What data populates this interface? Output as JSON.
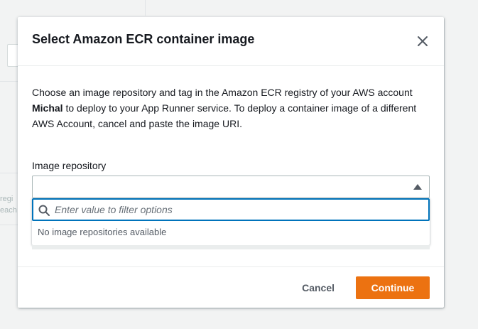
{
  "background": {
    "fragments": [
      "regi",
      "each"
    ]
  },
  "modal": {
    "title": "Select Amazon ECR container image",
    "close_icon": "close-icon",
    "description": {
      "part1": "Choose an image repository and tag in the Amazon ECR registry of your AWS account ",
      "account": "Michal",
      "part2": " to deploy to your App Runner service. To deploy a container image of a different AWS Account, cancel and paste the image URI."
    },
    "image_repository": {
      "label": "Image repository",
      "value": "",
      "filter_placeholder": "Enter value to filter options",
      "empty_message": "No image repositories available"
    },
    "footer": {
      "cancel_label": "Cancel",
      "continue_label": "Continue"
    }
  },
  "colors": {
    "primary_button": "#ec7211",
    "focus_border": "#0073bb"
  }
}
